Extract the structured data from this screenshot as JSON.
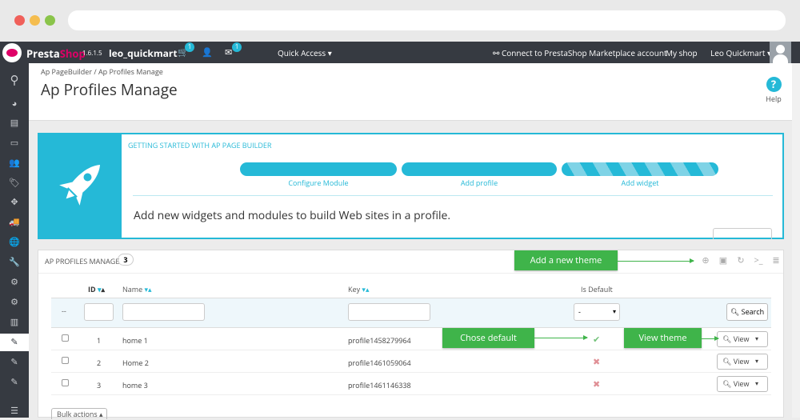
{
  "topbar": {
    "brand_presta": "Presta",
    "brand_shop": "Shop",
    "version": "1.6.1.5",
    "shop_name": "leo_quickmart",
    "cart_badge": "1",
    "mail_badge": "1",
    "quick_access": "Quick Access ▾",
    "connect": "Connect to PrestaShop Marketplace account",
    "my_shop": "My shop",
    "user": "Leo Quickmart ▾"
  },
  "breadcrumb": "Ap PageBuilder  /  Ap Profiles Manage",
  "page_title": "Ap Profiles Manage",
  "help_label": "Help",
  "getting_started": {
    "title": "GETTING STARTED WITH AP PAGE BUILDER",
    "steps": [
      "Configure Module",
      "Add profile",
      "Add widget"
    ],
    "text": "Add new widgets and modules to build Web sites in a profile."
  },
  "list": {
    "title": "AP PROFILES MANAGE",
    "count": "3",
    "headers": {
      "id": "ID",
      "name": "Name",
      "key": "Key",
      "is_default": "Is Default"
    },
    "filter_dash": "--",
    "select_value": "-",
    "search_label": "Search",
    "view_label": "View",
    "rows": [
      {
        "id": "1",
        "name": "home 1",
        "key": "profile1458279964",
        "default": true
      },
      {
        "id": "2",
        "name": "Home 2",
        "key": "profile1461059064",
        "default": false
      },
      {
        "id": "3",
        "name": "home 3",
        "key": "profile1461146338",
        "default": false
      }
    ],
    "bulk_label": "Bulk actions"
  },
  "callouts": {
    "add_theme": "Add a new theme",
    "chose_default": "Chose default",
    "view_theme": "View theme"
  }
}
